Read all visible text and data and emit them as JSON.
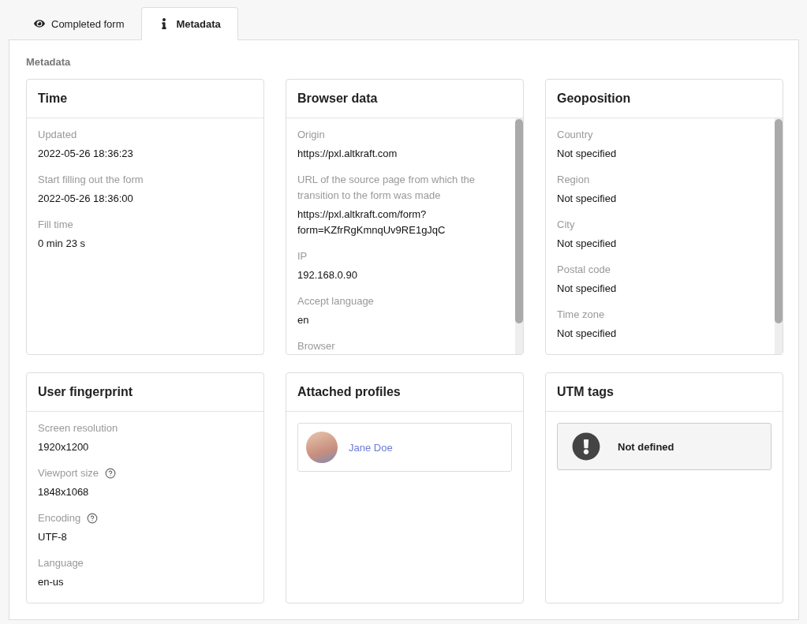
{
  "tabs": [
    {
      "label": "Completed form",
      "selected": false
    },
    {
      "label": "Metadata",
      "selected": true
    }
  ],
  "section_title": "Metadata",
  "cards": [
    {
      "kind": "fields",
      "title": "Time",
      "scrollable": false,
      "fields": [
        {
          "label": "Updated",
          "value": "2022-05-26 18:36:23",
          "help": false
        },
        {
          "label": "Start filling out the form",
          "value": "2022-05-26 18:36:00",
          "help": false
        },
        {
          "label": "Fill time",
          "value": "0 min 23 s",
          "help": false
        }
      ]
    },
    {
      "kind": "fields",
      "title": "Browser data",
      "scrollable": true,
      "fields": [
        {
          "label": "Origin",
          "value": "https://pxl.altkraft.com",
          "help": false
        },
        {
          "label": "URL of the source page from which the transition to the form was made",
          "value": "https://pxl.altkraft.com/form?form=KZfrRgKmnqUv9RE1gJqC",
          "help": false
        },
        {
          "label": "IP",
          "value": "192.168.0.90",
          "help": false
        },
        {
          "label": "Accept language",
          "value": "en",
          "help": false
        },
        {
          "label": "Browser",
          "help": false
        }
      ]
    },
    {
      "kind": "fields",
      "title": "Geoposition",
      "scrollable": true,
      "fields": [
        {
          "label": "Country",
          "value": "Not specified",
          "help": false
        },
        {
          "label": "Region",
          "value": "Not specified",
          "help": false
        },
        {
          "label": "City",
          "value": "Not specified",
          "help": false
        },
        {
          "label": "Postal code",
          "value": "Not specified",
          "help": false
        },
        {
          "label": "Time zone",
          "value": "Not specified",
          "help": false
        }
      ]
    },
    {
      "kind": "fields",
      "title": "User fingerprint",
      "scrollable": false,
      "fields": [
        {
          "label": "Screen resolution",
          "value": "1920x1200",
          "help": false
        },
        {
          "label": "Viewport size",
          "value": "1848x1068",
          "help": true
        },
        {
          "label": "Encoding",
          "value": "UTF-8",
          "help": true
        },
        {
          "label": "Language",
          "value": "en-us",
          "help": false
        }
      ]
    },
    {
      "kind": "profiles",
      "title": "Attached profiles",
      "scrollable": false,
      "profiles": [
        {
          "name": "Jane Doe"
        }
      ]
    },
    {
      "kind": "notice",
      "title": "UTM tags",
      "scrollable": false,
      "message": "Not defined"
    }
  ]
}
